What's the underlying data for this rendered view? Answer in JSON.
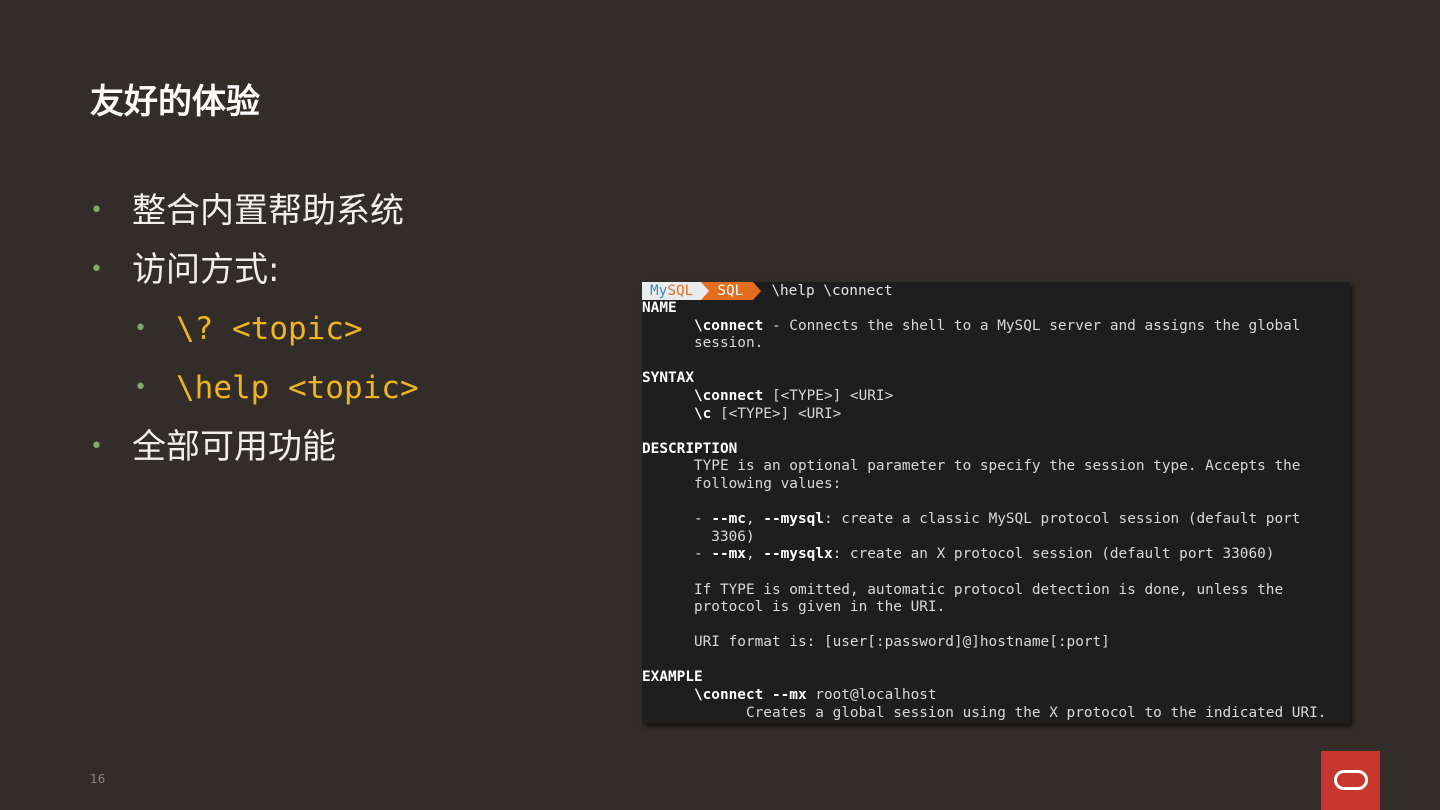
{
  "title": "友好的体验",
  "bullets": [
    {
      "text": "整合内置帮助系统",
      "level": 1
    },
    {
      "text": "访问方式:",
      "level": 1
    },
    {
      "text": "\\? <topic>",
      "level": 2
    },
    {
      "text": "\\help <topic>",
      "level": 2
    },
    {
      "text": "全部可用功能",
      "level": 1
    }
  ],
  "terminal": {
    "prompt_my": "My",
    "prompt_sql_part": "SQL",
    "prompt_mode": "SQL",
    "command": "\\help \\connect",
    "lines": [
      [
        {
          "t": "NAME",
          "b": true
        }
      ],
      [
        {
          "t": "      "
        },
        {
          "t": "\\connect",
          "b": true
        },
        {
          "t": " - Connects the shell to a MySQL server and assigns the global"
        }
      ],
      [
        {
          "t": "      session."
        }
      ],
      [],
      [
        {
          "t": "SYNTAX",
          "b": true
        }
      ],
      [
        {
          "t": "      "
        },
        {
          "t": "\\connect",
          "b": true
        },
        {
          "t": " [<TYPE>] <URI>"
        }
      ],
      [
        {
          "t": "      "
        },
        {
          "t": "\\c",
          "b": true
        },
        {
          "t": " [<TYPE>] <URI>"
        }
      ],
      [],
      [
        {
          "t": "DESCRIPTION",
          "b": true
        }
      ],
      [
        {
          "t": "      TYPE is an optional parameter to specify the session type. Accepts the"
        }
      ],
      [
        {
          "t": "      following values:"
        }
      ],
      [],
      [
        {
          "t": "      - "
        },
        {
          "t": "--mc",
          "b": true
        },
        {
          "t": ", "
        },
        {
          "t": "--mysql",
          "b": true
        },
        {
          "t": ": create a classic MySQL protocol session (default port"
        }
      ],
      [
        {
          "t": "        3306)"
        }
      ],
      [
        {
          "t": "      - "
        },
        {
          "t": "--mx",
          "b": true
        },
        {
          "t": ", "
        },
        {
          "t": "--mysqlx",
          "b": true
        },
        {
          "t": ": create an X protocol session (default port 33060)"
        }
      ],
      [],
      [
        {
          "t": "      If TYPE is omitted, automatic protocol detection is done, unless the"
        }
      ],
      [
        {
          "t": "      protocol is given in the URI."
        }
      ],
      [],
      [
        {
          "t": "      URI format is: [user[:password]@]hostname[:port]"
        }
      ],
      [],
      [
        {
          "t": "EXAMPLE",
          "b": true
        }
      ],
      [
        {
          "t": "      "
        },
        {
          "t": "\\connect --mx",
          "b": true
        },
        {
          "t": " root@localhost"
        }
      ],
      [
        {
          "t": "            Creates a global session using the X protocol to the indicated URI."
        }
      ]
    ]
  },
  "page_number": "16",
  "colors": {
    "background": "#322d29",
    "accent": "#f0b41e",
    "brand": "#c8372d"
  }
}
